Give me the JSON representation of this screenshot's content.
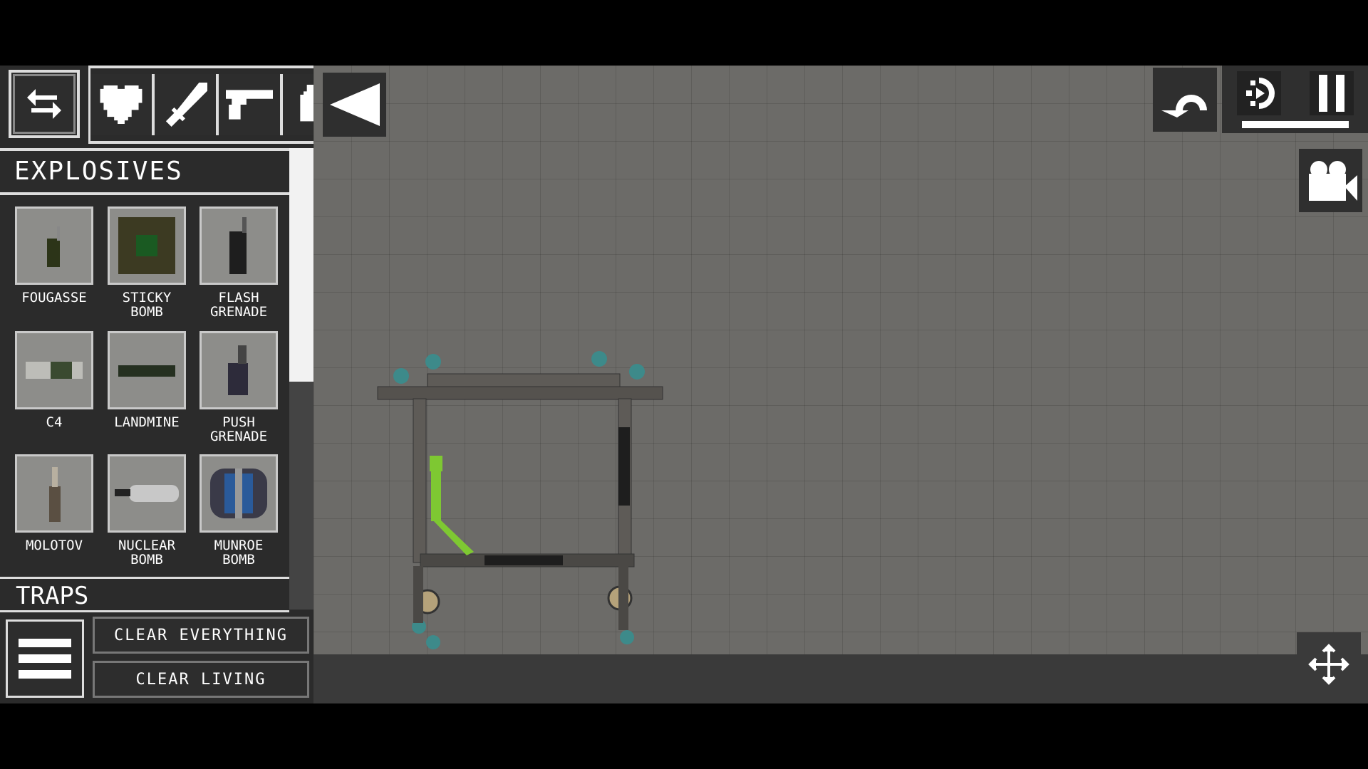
{
  "toolbar": {
    "swap_icon": "swap-arrows-icon",
    "categories": [
      {
        "icon": "heart-icon"
      },
      {
        "icon": "sword-icon"
      },
      {
        "icon": "pistol-icon"
      },
      {
        "icon": "grenade-icon"
      }
    ],
    "collapse_icon": "triangle-left-icon"
  },
  "sidebar": {
    "category_title": "EXPLOSIVES",
    "items": [
      {
        "label": "FOUGASSE"
      },
      {
        "label": "STICKY\nBOMB"
      },
      {
        "label": "FLASH\nGRENADE"
      },
      {
        "label": "C4"
      },
      {
        "label": "LANDMINE"
      },
      {
        "label": "PUSH\nGRENADE"
      },
      {
        "label": "MOLOTOV"
      },
      {
        "label": "NUCLEAR\nBOMB"
      },
      {
        "label": "MUNROE\nBOMB"
      }
    ],
    "next_category": "TRAPS"
  },
  "bottom": {
    "clear_everything": "CLEAR EVERYTHING",
    "clear_living": "CLEAR LIVING"
  },
  "controls": {
    "undo_icon": "undo-icon",
    "slowmo_icon": "slow-motion-icon",
    "pause_icon": "pause-icon",
    "camera_icon": "camera-icon",
    "move_icon": "move-icon",
    "time_scale_fill": 1.0
  }
}
